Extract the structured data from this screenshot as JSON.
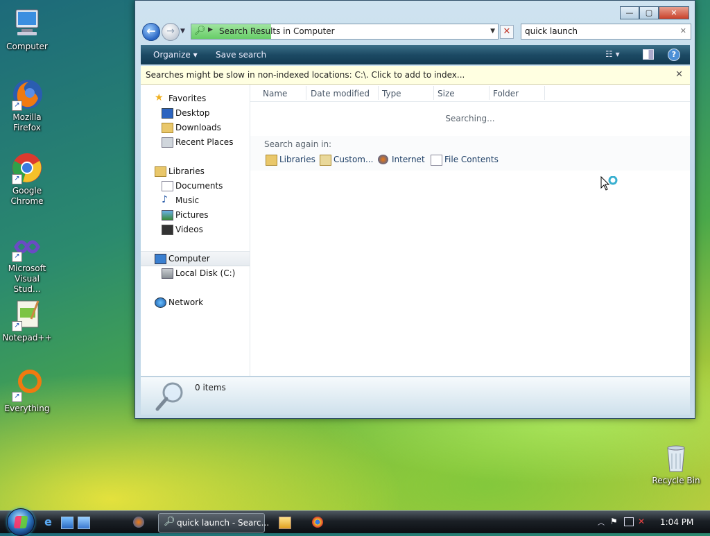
{
  "desktop": {
    "icons": [
      {
        "label": "Computer",
        "icon": "computer-icon"
      },
      {
        "label": "Mozilla Firefox",
        "line1": "Mozilla",
        "line2": "Firefox",
        "icon": "firefox-icon"
      },
      {
        "label": "Google Chrome",
        "line1": "Google",
        "line2": "Chrome",
        "icon": "chrome-icon"
      },
      {
        "label": "Microsoft Visual Stud...",
        "line1": "Microsoft",
        "line2": "Visual Stud...",
        "icon": "visual-studio-icon"
      },
      {
        "label": "Notepad++",
        "icon": "notepad-plus-plus-icon"
      },
      {
        "label": "Everything",
        "icon": "everything-search-icon"
      },
      {
        "label": "Recycle Bin",
        "icon": "recycle-bin-icon"
      }
    ]
  },
  "window": {
    "caption_buttons": {
      "minimize": "—",
      "maximize": "▢",
      "close": "✕"
    },
    "address": {
      "text": "Search Results in Computer",
      "progress_percent": 26
    },
    "search": {
      "value": "quick launch"
    },
    "toolbar": {
      "organize": "Organize",
      "save_search": "Save search"
    },
    "infobar": {
      "message": "Searches might be slow in non-indexed locations: C:\\. Click to add to index..."
    },
    "nav": {
      "favorites": "Favorites",
      "desktop": "Desktop",
      "downloads": "Downloads",
      "recent_places": "Recent Places",
      "libraries": "Libraries",
      "documents": "Documents",
      "music": "Music",
      "pictures": "Pictures",
      "videos": "Videos",
      "computer": "Computer",
      "local_disk": "Local Disk (C:)",
      "network": "Network"
    },
    "columns": [
      "Name",
      "Date modified",
      "Type",
      "Size",
      "Folder"
    ],
    "status": "Searching...",
    "search_again": {
      "label": "Search again in:",
      "items": [
        "Libraries",
        "Custom...",
        "Internet",
        "File Contents"
      ]
    },
    "details": {
      "count": "0 items"
    }
  },
  "taskbar": {
    "active_task": "quick launch - Searc...",
    "clock": "1:04 PM"
  },
  "colors": {
    "accent": "#1c4a64",
    "infobar": "#ffffe1",
    "progress": "#4cc44c"
  }
}
